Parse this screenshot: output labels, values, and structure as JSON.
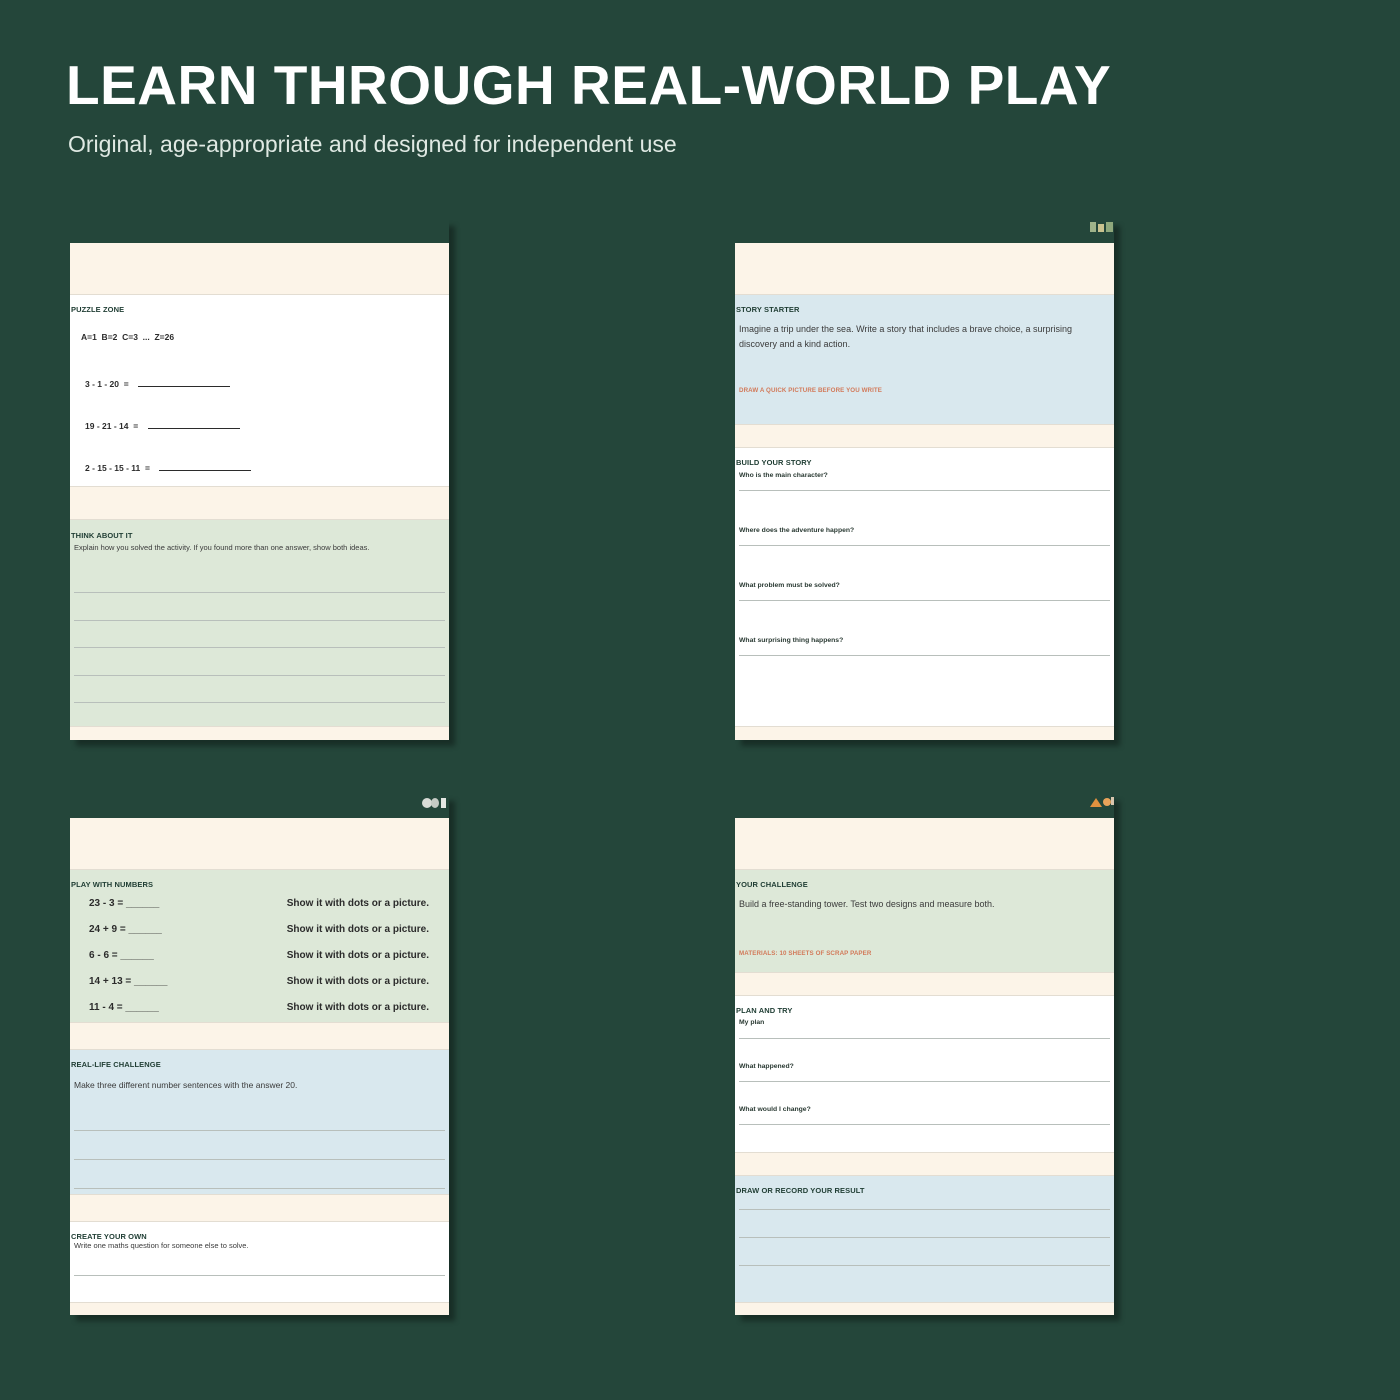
{
  "header": {
    "title": "LEARN THROUGH REAL-WORLD PLAY",
    "subtitle": "Original, age-appropriate and designed for independent use"
  },
  "colors": {
    "background": "#24463a",
    "cream": "#fcf4e8",
    "green_panel": "#dde8d8",
    "blue_panel": "#d9e8ee",
    "accent_orange": "#d27a5a"
  },
  "cards": {
    "puzzle": {
      "puzzle_heading": "PUZZLE ZONE",
      "key": "A=1  B=2  C=3  ...  Z=26",
      "codes": [
        "3 - 1 - 20  =",
        "19 - 21 - 14  =",
        "2 - 15 - 15 - 11  ="
      ],
      "think_heading": "THINK ABOUT IT",
      "think_text": "Explain how you solved the activity. If you found more than one answer, show both ideas."
    },
    "story": {
      "starter_heading": "STORY STARTER",
      "starter_text": "Imagine a trip under the sea. Write a story that includes a brave choice, a surprising discovery and a kind action.",
      "draw_note": "DRAW A QUICK PICTURE BEFORE YOU WRITE",
      "build_heading": "BUILD YOUR STORY",
      "questions": [
        "Who is the main character?",
        "Where does the adventure happen?",
        "What problem must be solved?",
        "What surprising thing happens?"
      ]
    },
    "numbers": {
      "numbers_heading": "PLAY WITH NUMBERS",
      "rows": [
        {
          "expr": "23 - 3 = ______",
          "show": "Show it with dots or a picture."
        },
        {
          "expr": "24 + 9 = ______",
          "show": "Show it with dots or a picture."
        },
        {
          "expr": "6 - 6 = ______",
          "show": "Show it with dots or a picture."
        },
        {
          "expr": "14 + 13 = ______",
          "show": "Show it with dots or a picture."
        },
        {
          "expr": "11 - 4 = ______",
          "show": "Show it with dots or a picture."
        }
      ],
      "challenge_heading": "REAL-LIFE CHALLENGE",
      "challenge_text": "Make three different number sentences with the answer 20.",
      "create_heading": "CREATE YOUR OWN",
      "create_text": "Write one maths question for someone else to solve."
    },
    "tower": {
      "challenge_heading": "YOUR CHALLENGE",
      "challenge_text": "Build a free-standing tower. Test two designs and measure both.",
      "materials_note": "MATERIALS: 10 SHEETS OF SCRAP PAPER",
      "plan_heading": "PLAN AND TRY",
      "prompts": [
        "My plan",
        "What happened?",
        "What would I change?"
      ],
      "result_heading": "DRAW OR RECORD YOUR RESULT"
    }
  }
}
